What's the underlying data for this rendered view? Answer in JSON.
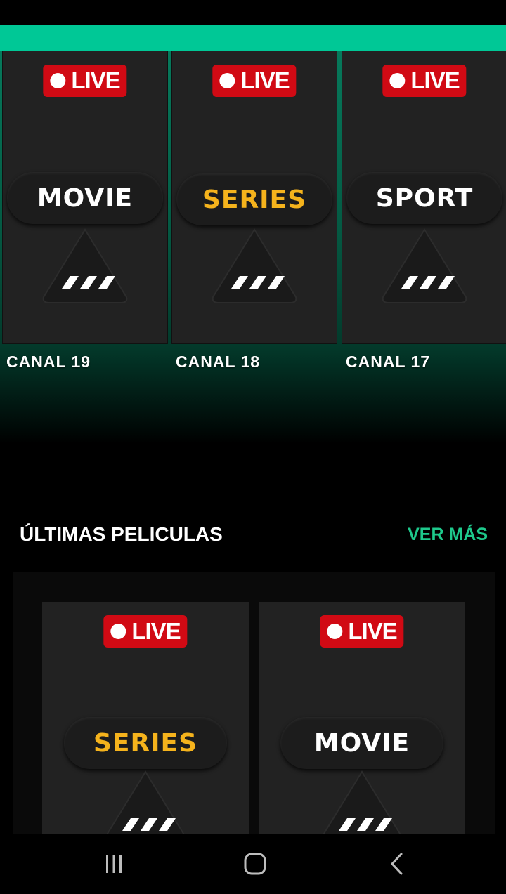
{
  "channels": [
    {
      "live_label": "LIVE",
      "genre": "MOVIE",
      "genre_color": "#ffffff",
      "caption": "CANAL 19"
    },
    {
      "live_label": "LIVE",
      "genre": "SERIES",
      "genre_color": "#f5b31c",
      "caption": "CANAL 18"
    },
    {
      "live_label": "LIVE",
      "genre": "SPORT",
      "genre_color": "#ffffff",
      "caption": "CANAL 17"
    }
  ],
  "latest": {
    "title": "ÚLTIMAS PELICULAS",
    "see_more": "VER MÁS",
    "items": [
      {
        "live_label": "LIVE",
        "genre": "SERIES",
        "genre_color": "#f5b31c"
      },
      {
        "live_label": "LIVE",
        "genre": "MOVIE",
        "genre_color": "#ffffff"
      }
    ]
  },
  "colors": {
    "accent": "#00c896",
    "live_red": "#d10a14",
    "see_more": "#1ec98c"
  },
  "nav": {
    "icons": [
      "recents-icon",
      "home-icon",
      "back-icon"
    ]
  }
}
